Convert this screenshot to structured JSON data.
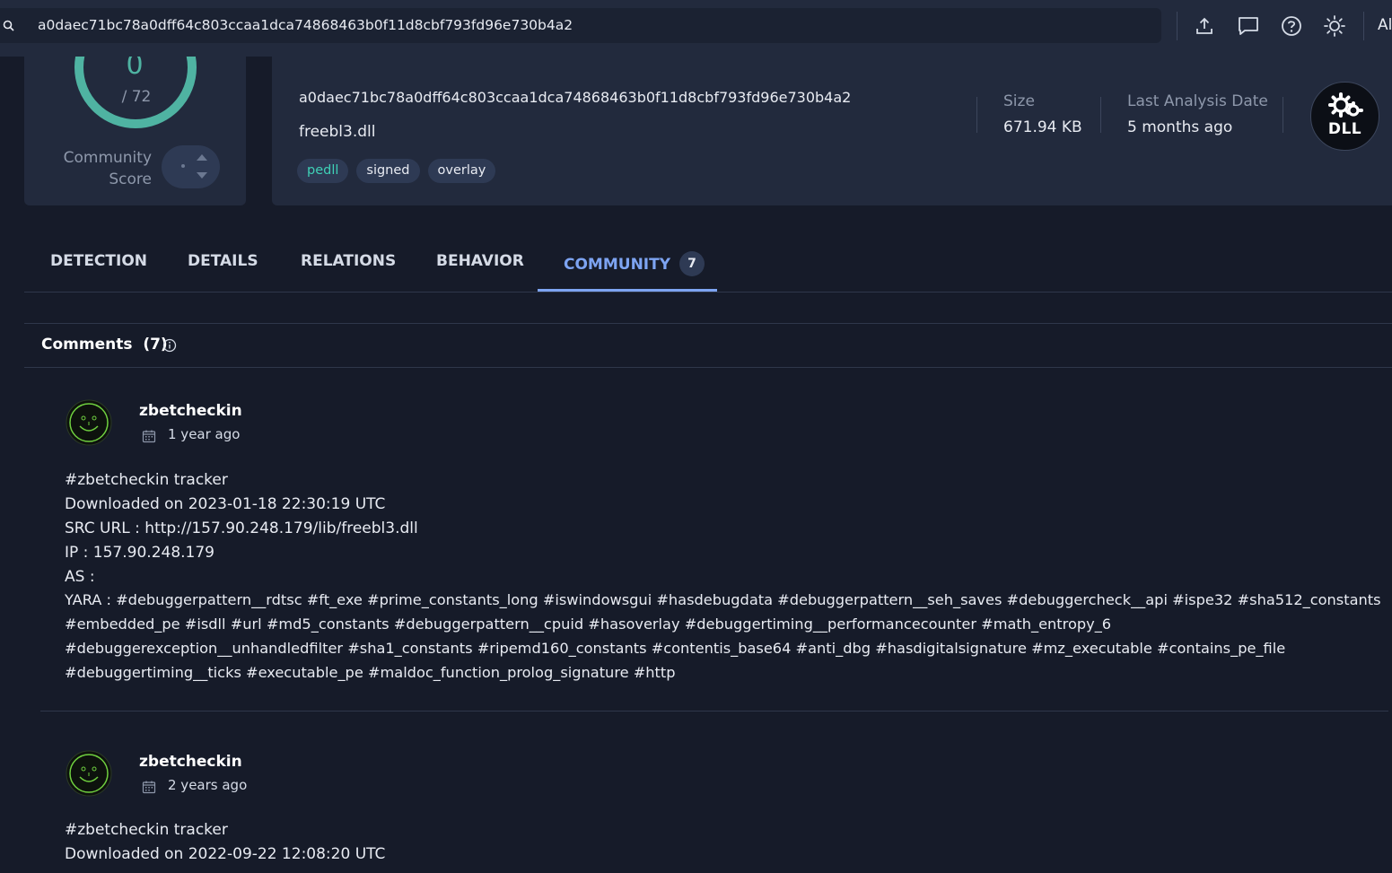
{
  "search": {
    "value": "a0daec71bc78a0dff64c803ccaa1dca74868463b0f11d8cbf793fd96e730b4a2",
    "cutoff_label": "Al"
  },
  "toolbar": {
    "icons": [
      "upload-icon",
      "chat-icon",
      "help-icon",
      "theme-icon"
    ]
  },
  "score": {
    "value": "0",
    "total": "/ 72",
    "label_line1": "Community",
    "label_line2": "Score",
    "score_fraction": 0,
    "ring_color": "#4fb3a2"
  },
  "file": {
    "hash": "a0daec71bc78a0dff64c803ccaa1dca74868463b0f11d8cbf793fd96e730b4a2",
    "name": "freebl3.dll",
    "tags": [
      "pedll",
      "signed",
      "overlay"
    ],
    "size_label": "Size",
    "size_value": "671.94 KB",
    "date_label": "Last Analysis Date",
    "date_value": "5 months ago",
    "type_badge": "DLL"
  },
  "tabs": [
    {
      "label": "DETECTION"
    },
    {
      "label": "DETAILS"
    },
    {
      "label": "RELATIONS"
    },
    {
      "label": "BEHAVIOR"
    },
    {
      "label": "COMMUNITY",
      "count": "7",
      "active": true
    }
  ],
  "comments": {
    "title": "Comments",
    "count": "(7)",
    "items": [
      {
        "user": "zbetcheckin",
        "time": "1 year ago",
        "lines": [
          "#zbetcheckin tracker",
          "Downloaded on 2023-01-18 22:30:19 UTC",
          "SRC URL : http://157.90.248.179/lib/freebl3.dll",
          "IP : 157.90.248.179",
          "AS :",
          "YARA : #debuggerpattern__rdtsc #ft_exe #prime_constants_long #iswindowsgui #hasdebugdata #debuggerpattern__seh_saves #debuggercheck__api #ispe32 #sha512_constants",
          "#embedded_pe #isdll #url #md5_constants #debuggerpattern__cpuid #hasoverlay #debuggertiming__performancecounter #math_entropy_6",
          "#debuggerexception__unhandledfilter #sha1_constants #ripemd160_constants #contentis_base64 #anti_dbg #hasdigitalsignature #mz_executable #contains_pe_file",
          "#debuggertiming__ticks #executable_pe #maldoc_function_prolog_signature #http"
        ]
      },
      {
        "user": "zbetcheckin",
        "time": "2 years ago",
        "lines": [
          "#zbetcheckin tracker",
          "Downloaded on 2022-09-22 12:08:20 UTC"
        ]
      }
    ]
  },
  "colors": {
    "background": "#161b29",
    "panel": "#222a3d",
    "accent_blue": "#7da4f2",
    "accent_teal": "#3fd0b6",
    "avatar_green": "#6fcf3f"
  }
}
